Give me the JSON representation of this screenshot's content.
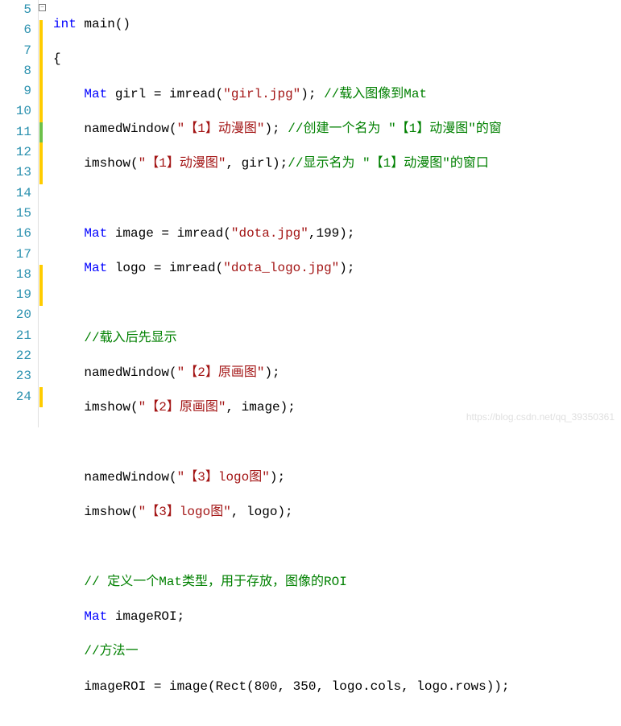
{
  "gutter": {
    "start": 5,
    "end": 24
  },
  "code": {
    "l5": {
      "kw": "int",
      "func": " main",
      "p1": "()"
    },
    "l6": {
      "brace": "{"
    },
    "l7": {
      "type": "Mat",
      "id": " girl = ",
      "fn": "imread",
      "p1": "(",
      "s": "\"girl.jpg\"",
      "p2": ");",
      "c": " //载入图像到Mat"
    },
    "l8": {
      "fn": "namedWindow",
      "p1": "(",
      "s": "\"【1】动漫图\"",
      "p2": ");",
      "c": " //创建一个名为 \"【1】动漫图\"的窗"
    },
    "l9": {
      "fn": "imshow",
      "p1": "(",
      "s": "\"【1】动漫图\"",
      "p2": ", girl);",
      "c": "//显示名为 \"【1】动漫图\"的窗口"
    },
    "l11": {
      "type": "Mat",
      "id": " image = ",
      "fn": "imread",
      "p1": "(",
      "s": "\"dota.jpg\"",
      "p2": ",199);"
    },
    "l12": {
      "type": "Mat",
      "id": " logo = ",
      "fn": "imread",
      "p1": "(",
      "s": "\"dota_logo.jpg\"",
      "p2": ");"
    },
    "l14": {
      "c": "//载入后先显示"
    },
    "l15": {
      "fn": "namedWindow",
      "p1": "(",
      "s": "\"【2】原画图\"",
      "p2": ");"
    },
    "l16": {
      "fn": "imshow",
      "p1": "(",
      "s": "\"【2】原画图\"",
      "p2": ", image);"
    },
    "l18": {
      "fn": "namedWindow",
      "p1": "(",
      "s": "\"【3】logo图\"",
      "p2": ");"
    },
    "l19": {
      "fn": "imshow",
      "p1": "(",
      "s": "\"【3】logo图\"",
      "p2": ", logo);"
    },
    "l21": {
      "c": "// 定义一个Mat类型，用于存放，图像的ROI"
    },
    "l22": {
      "type": "Mat",
      "id": " imageROI;"
    },
    "l23": {
      "c": "//方法一"
    },
    "l24": {
      "id1": "imageROI = image(",
      "fn": "Rect",
      "p1": "(800, 350, logo.cols, logo.rows));"
    }
  },
  "watermark": "https://blog.csdn.net/qq_39350361"
}
